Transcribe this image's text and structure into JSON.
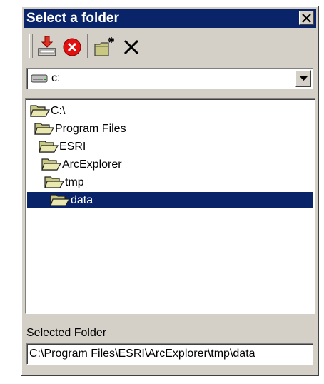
{
  "window": {
    "title": "Select a folder",
    "close_glyph": "✕"
  },
  "toolbar": {
    "buttons": [
      {
        "icon": "import-folder-icon"
      },
      {
        "icon": "delete-red-icon"
      },
      {
        "icon": "new-folder-icon"
      },
      {
        "icon": "close-x-icon"
      }
    ]
  },
  "drive": {
    "icon": "drive-icon",
    "value": "c:"
  },
  "tree": {
    "items": [
      {
        "label": "C:\\",
        "icon": "open-folder-icon",
        "selected": false
      },
      {
        "label": "Program Files",
        "icon": "open-folder-icon",
        "selected": false
      },
      {
        "label": "ESRI",
        "icon": "open-folder-icon",
        "selected": false
      },
      {
        "label": "ArcExplorer",
        "icon": "open-folder-icon",
        "selected": false
      },
      {
        "label": "tmp",
        "icon": "open-folder-icon",
        "selected": false
      },
      {
        "label": "data",
        "icon": "open-folder-icon",
        "selected": true
      }
    ]
  },
  "selected_folder": {
    "label": "Selected Folder",
    "value": "C:\\Program Files\\ESRI\\ArcExplorer\\tmp\\data"
  },
  "colors": {
    "title_bar": "#0a246a",
    "selection": "#0a246a",
    "face": "#d4d0c8",
    "folder": "#c8c882"
  }
}
